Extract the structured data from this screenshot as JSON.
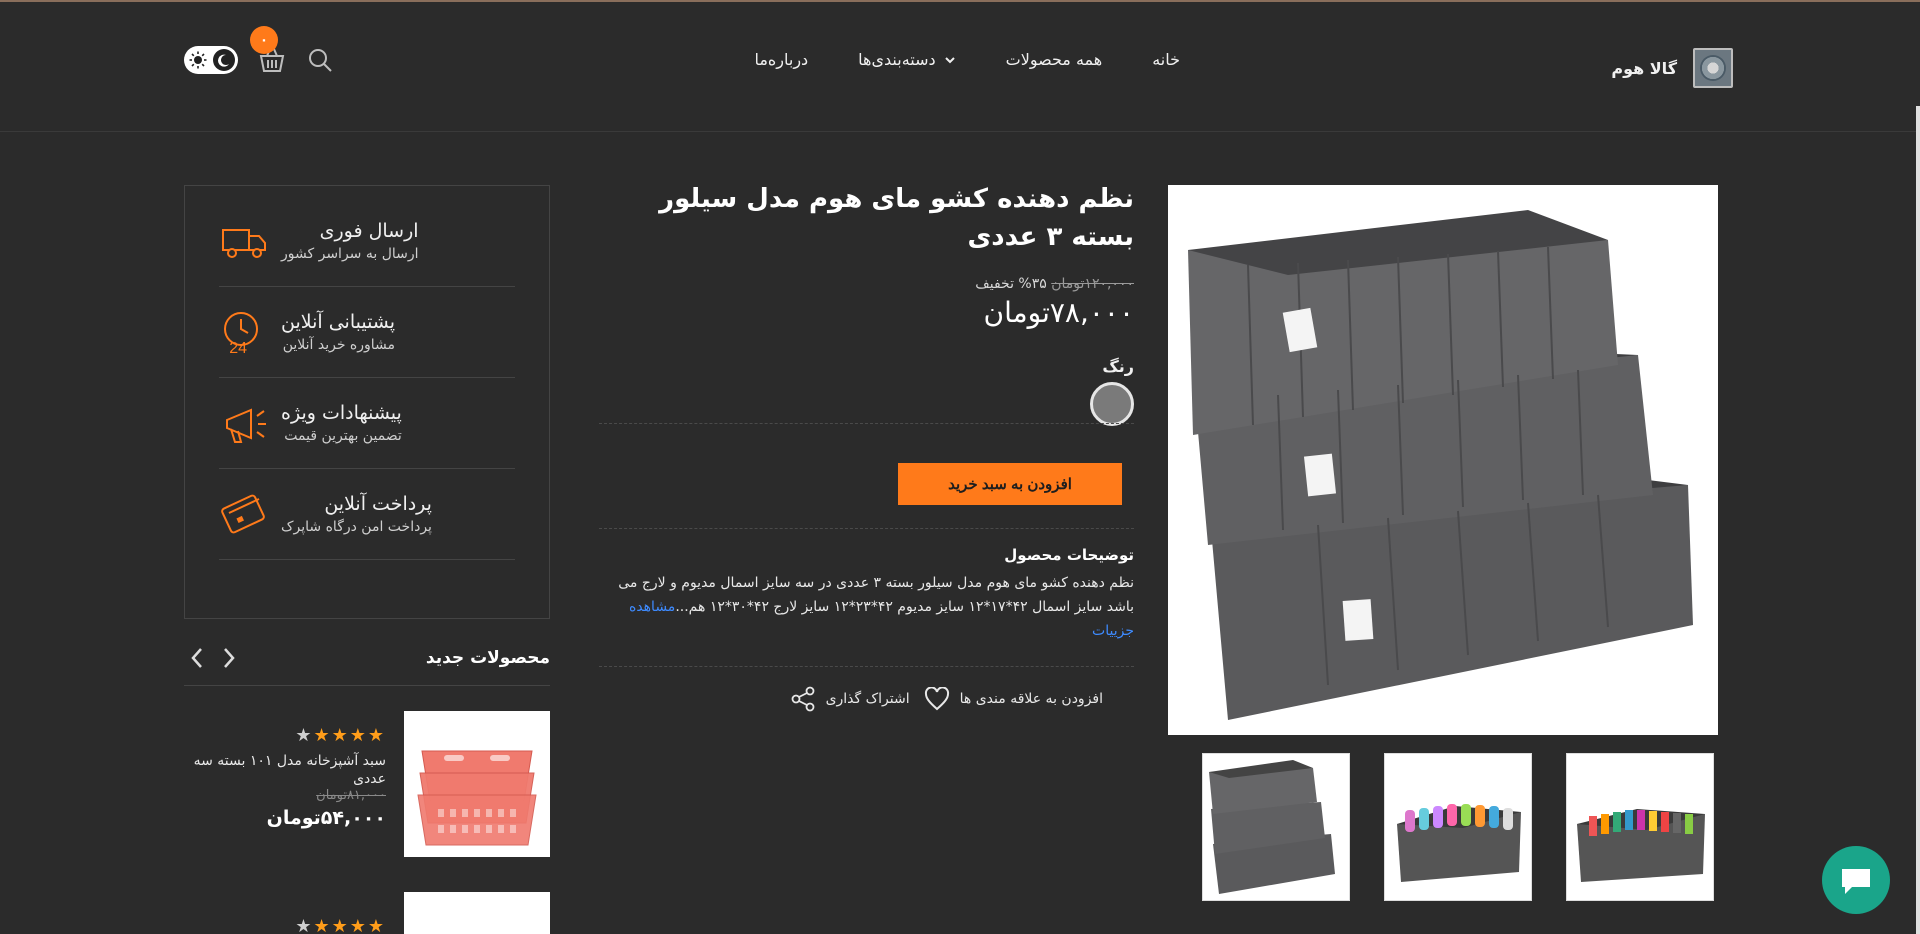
{
  "header": {
    "brand": "گالا هوم",
    "nav": [
      {
        "label": "خانه"
      },
      {
        "label": "همه محصولات"
      },
      {
        "label": "دسته‌بندی‌ها"
      },
      {
        "label": "درباره‌ما"
      }
    ],
    "cart_count": "۰"
  },
  "product": {
    "title": "نظم دهنده کشو مای هوم مدل سیلور بسته ۳ عددی",
    "old_price": "۱۲۰,۰۰۰تومان",
    "discount": "۳۵% تخفیف",
    "price": "۷۸,۰۰۰تومان",
    "color_label": "رنگ",
    "swatch_color": "#7a7a7a",
    "add_to_cart": "افزودن به سبد خرید",
    "description_title": "توضیحات محصول",
    "description": "نظم دهنده کشو مای هوم مدل سیلور بسته ۳ عددی در سه سایز اسمال مدیوم و لارج می باشد سایز اسمال ۴۲*۱۷*۱۲ سایز مدیوم ۴۲*۲۳*۱۲ سایز لارج ۴۲*۳۰*۱۲ هم...",
    "more_link": "مشاهده جزییات",
    "share": "اشتراک گذاری",
    "wishlist": "افزودن به علاقه مندی ها"
  },
  "features": [
    {
      "title": "ارسال فوری",
      "subtitle": "ارسال به سراسر کشور",
      "icon": "truck-icon"
    },
    {
      "title": "پشتیبانی آنلاین",
      "subtitle": "مشاوره خرید آنلاین",
      "icon": "clock-24-icon"
    },
    {
      "title": "پیشنهادات ویژه",
      "subtitle": "تضمین بهترین قیمت",
      "icon": "megaphone-icon"
    },
    {
      "title": "پرداخت آنلاین",
      "subtitle": "پرداخت امن درگاه شاپرک",
      "icon": "credit-card-icon"
    }
  ],
  "new_products": {
    "title": "محصولات جدید",
    "items": [
      {
        "name": "سبد آشپزخانه مدل ۱۰۱ بسته سه عددی",
        "old_price": "۸۱,۰۰۰تومان",
        "price": "۵۴,۰۰۰تومان",
        "rating": 4
      }
    ]
  },
  "colors": {
    "accent": "#ff7a1a",
    "background": "#2b2b2b",
    "chat": "#1aa58a"
  }
}
